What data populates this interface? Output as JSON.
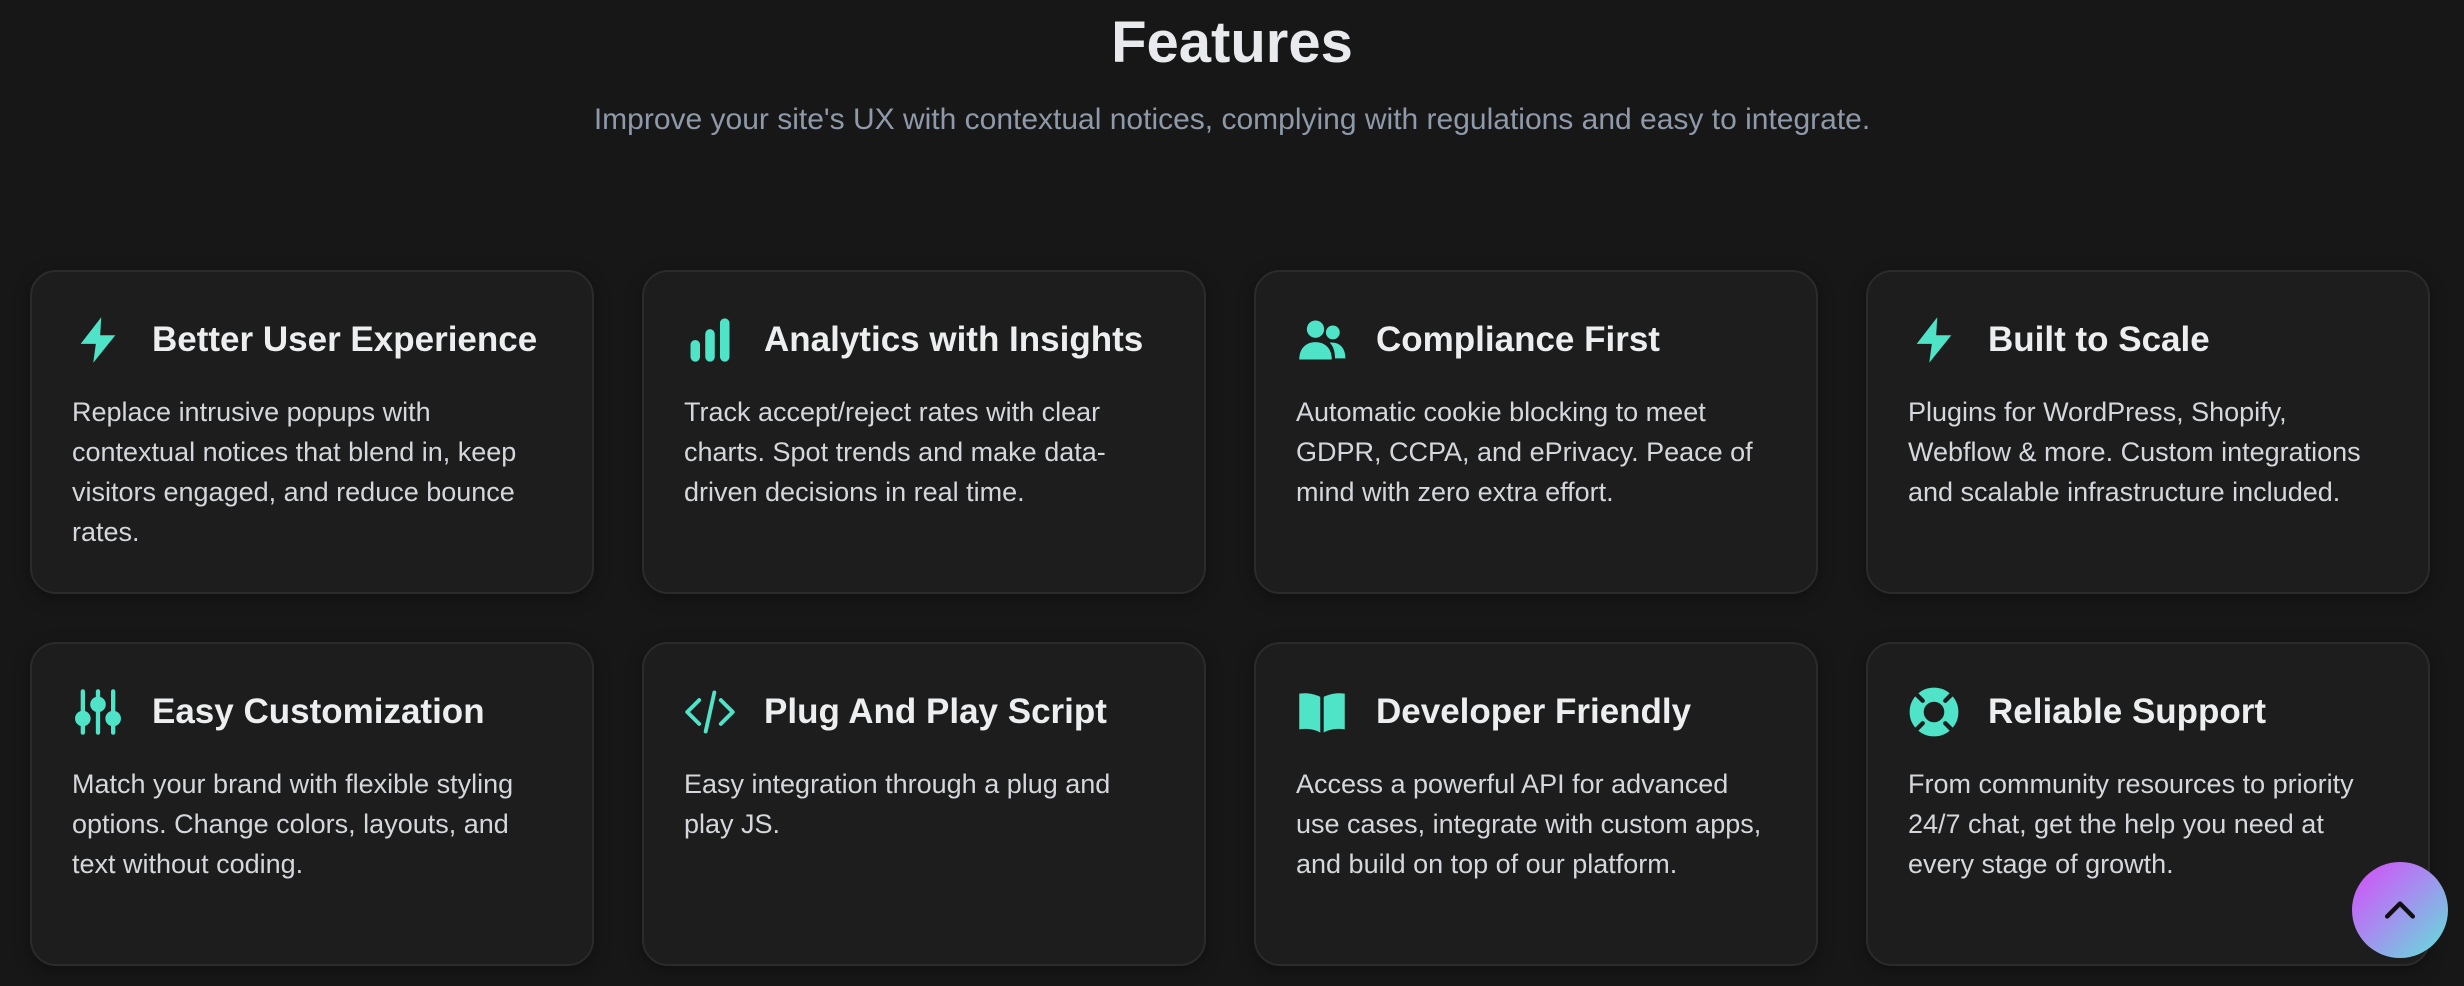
{
  "section": {
    "title": "Features",
    "subtitle": "Improve your site's UX with contextual notices, complying with regulations and easy to integrate."
  },
  "colors": {
    "background": "#171717",
    "card_background": "#1d1d1d",
    "accent": "#4fe3c8",
    "title_text": "#e8eaed",
    "subtitle_text": "#8e9aaa"
  },
  "features": [
    {
      "icon": "lightning-icon",
      "title": "Better User Experience",
      "description": "Replace intrusive popups with contextual notices that blend in, keep visitors engaged, and reduce bounce rates."
    },
    {
      "icon": "bar-chart-icon",
      "title": "Analytics with Insights",
      "description": "Track accept/reject rates with clear charts. Spot trends and make data-driven decisions in real time."
    },
    {
      "icon": "users-icon",
      "title": "Compliance First",
      "description": "Automatic cookie blocking to meet GDPR, CCPA, and ePrivacy. Peace of mind with zero extra effort."
    },
    {
      "icon": "lightning-icon",
      "title": "Built to Scale",
      "description": "Plugins for WordPress, Shopify, Webflow & more. Custom integrations and scalable infrastructure included."
    },
    {
      "icon": "sliders-icon",
      "title": "Easy Customization",
      "description": "Match your brand with flexible styling options. Change colors, layouts, and text without coding."
    },
    {
      "icon": "code-icon",
      "title": "Plug And Play Script",
      "description": "Easy integration through a plug and play JS."
    },
    {
      "icon": "book-open-icon",
      "title": "Developer Friendly",
      "description": "Access a powerful API for advanced use cases, integrate with custom apps, and build on top of our platform."
    },
    {
      "icon": "lifebuoy-icon",
      "title": "Reliable Support",
      "description": "From community resources to priority 24/7 chat, get the help you need at every stage of growth."
    }
  ],
  "scroll_top_button": {
    "icon": "chevron-up-icon"
  }
}
